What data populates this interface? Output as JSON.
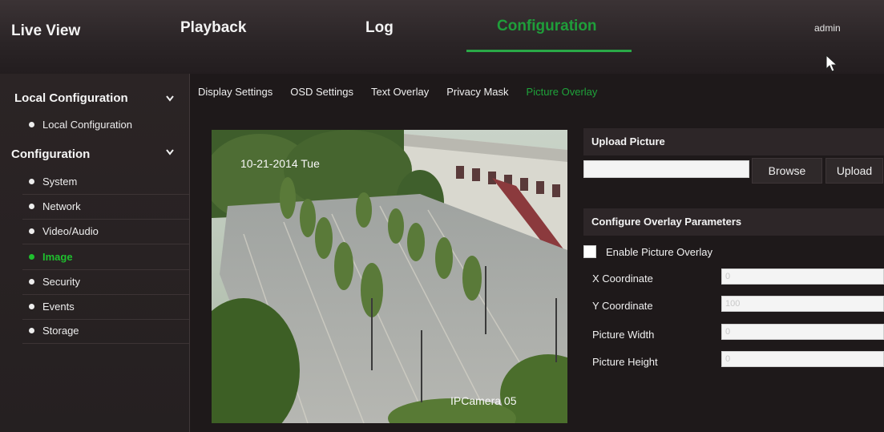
{
  "nav": {
    "live_view": "Live View",
    "playback": "Playback",
    "log": "Log",
    "configuration": "Configuration",
    "user": "admin",
    "active_color": "#1f9e3a"
  },
  "sidebar": {
    "local_section": {
      "title": "Local Configuration",
      "items": [
        "Local Configuration"
      ]
    },
    "config_section": {
      "title": "Configuration",
      "items": [
        "System",
        "Network",
        "Video/Audio",
        "Image",
        "Security",
        "Events",
        "Storage"
      ],
      "active": "Image"
    },
    "active_color": "#1fbf2e"
  },
  "tabs": {
    "items": [
      "Display Settings",
      "OSD Settings",
      "Text Overlay",
      "Privacy Mask",
      "Picture Overlay"
    ],
    "active": "Picture Overlay"
  },
  "video": {
    "timestamp": "10-21-2014 Tue",
    "camera_name": "IPCamera 05"
  },
  "upload": {
    "title": "Upload Picture",
    "file_value": "",
    "browse_label": "Browse",
    "upload_label": "Upload"
  },
  "overlay": {
    "title": "Configure Overlay Parameters",
    "enable_label": "Enable Picture Overlay",
    "enabled": false,
    "x_label": "X Coordinate",
    "x_value": "0",
    "y_label": "Y Coordinate",
    "y_value": "100",
    "width_label": "Picture Width",
    "width_value": "0",
    "height_label": "Picture Height",
    "height_value": "0"
  }
}
